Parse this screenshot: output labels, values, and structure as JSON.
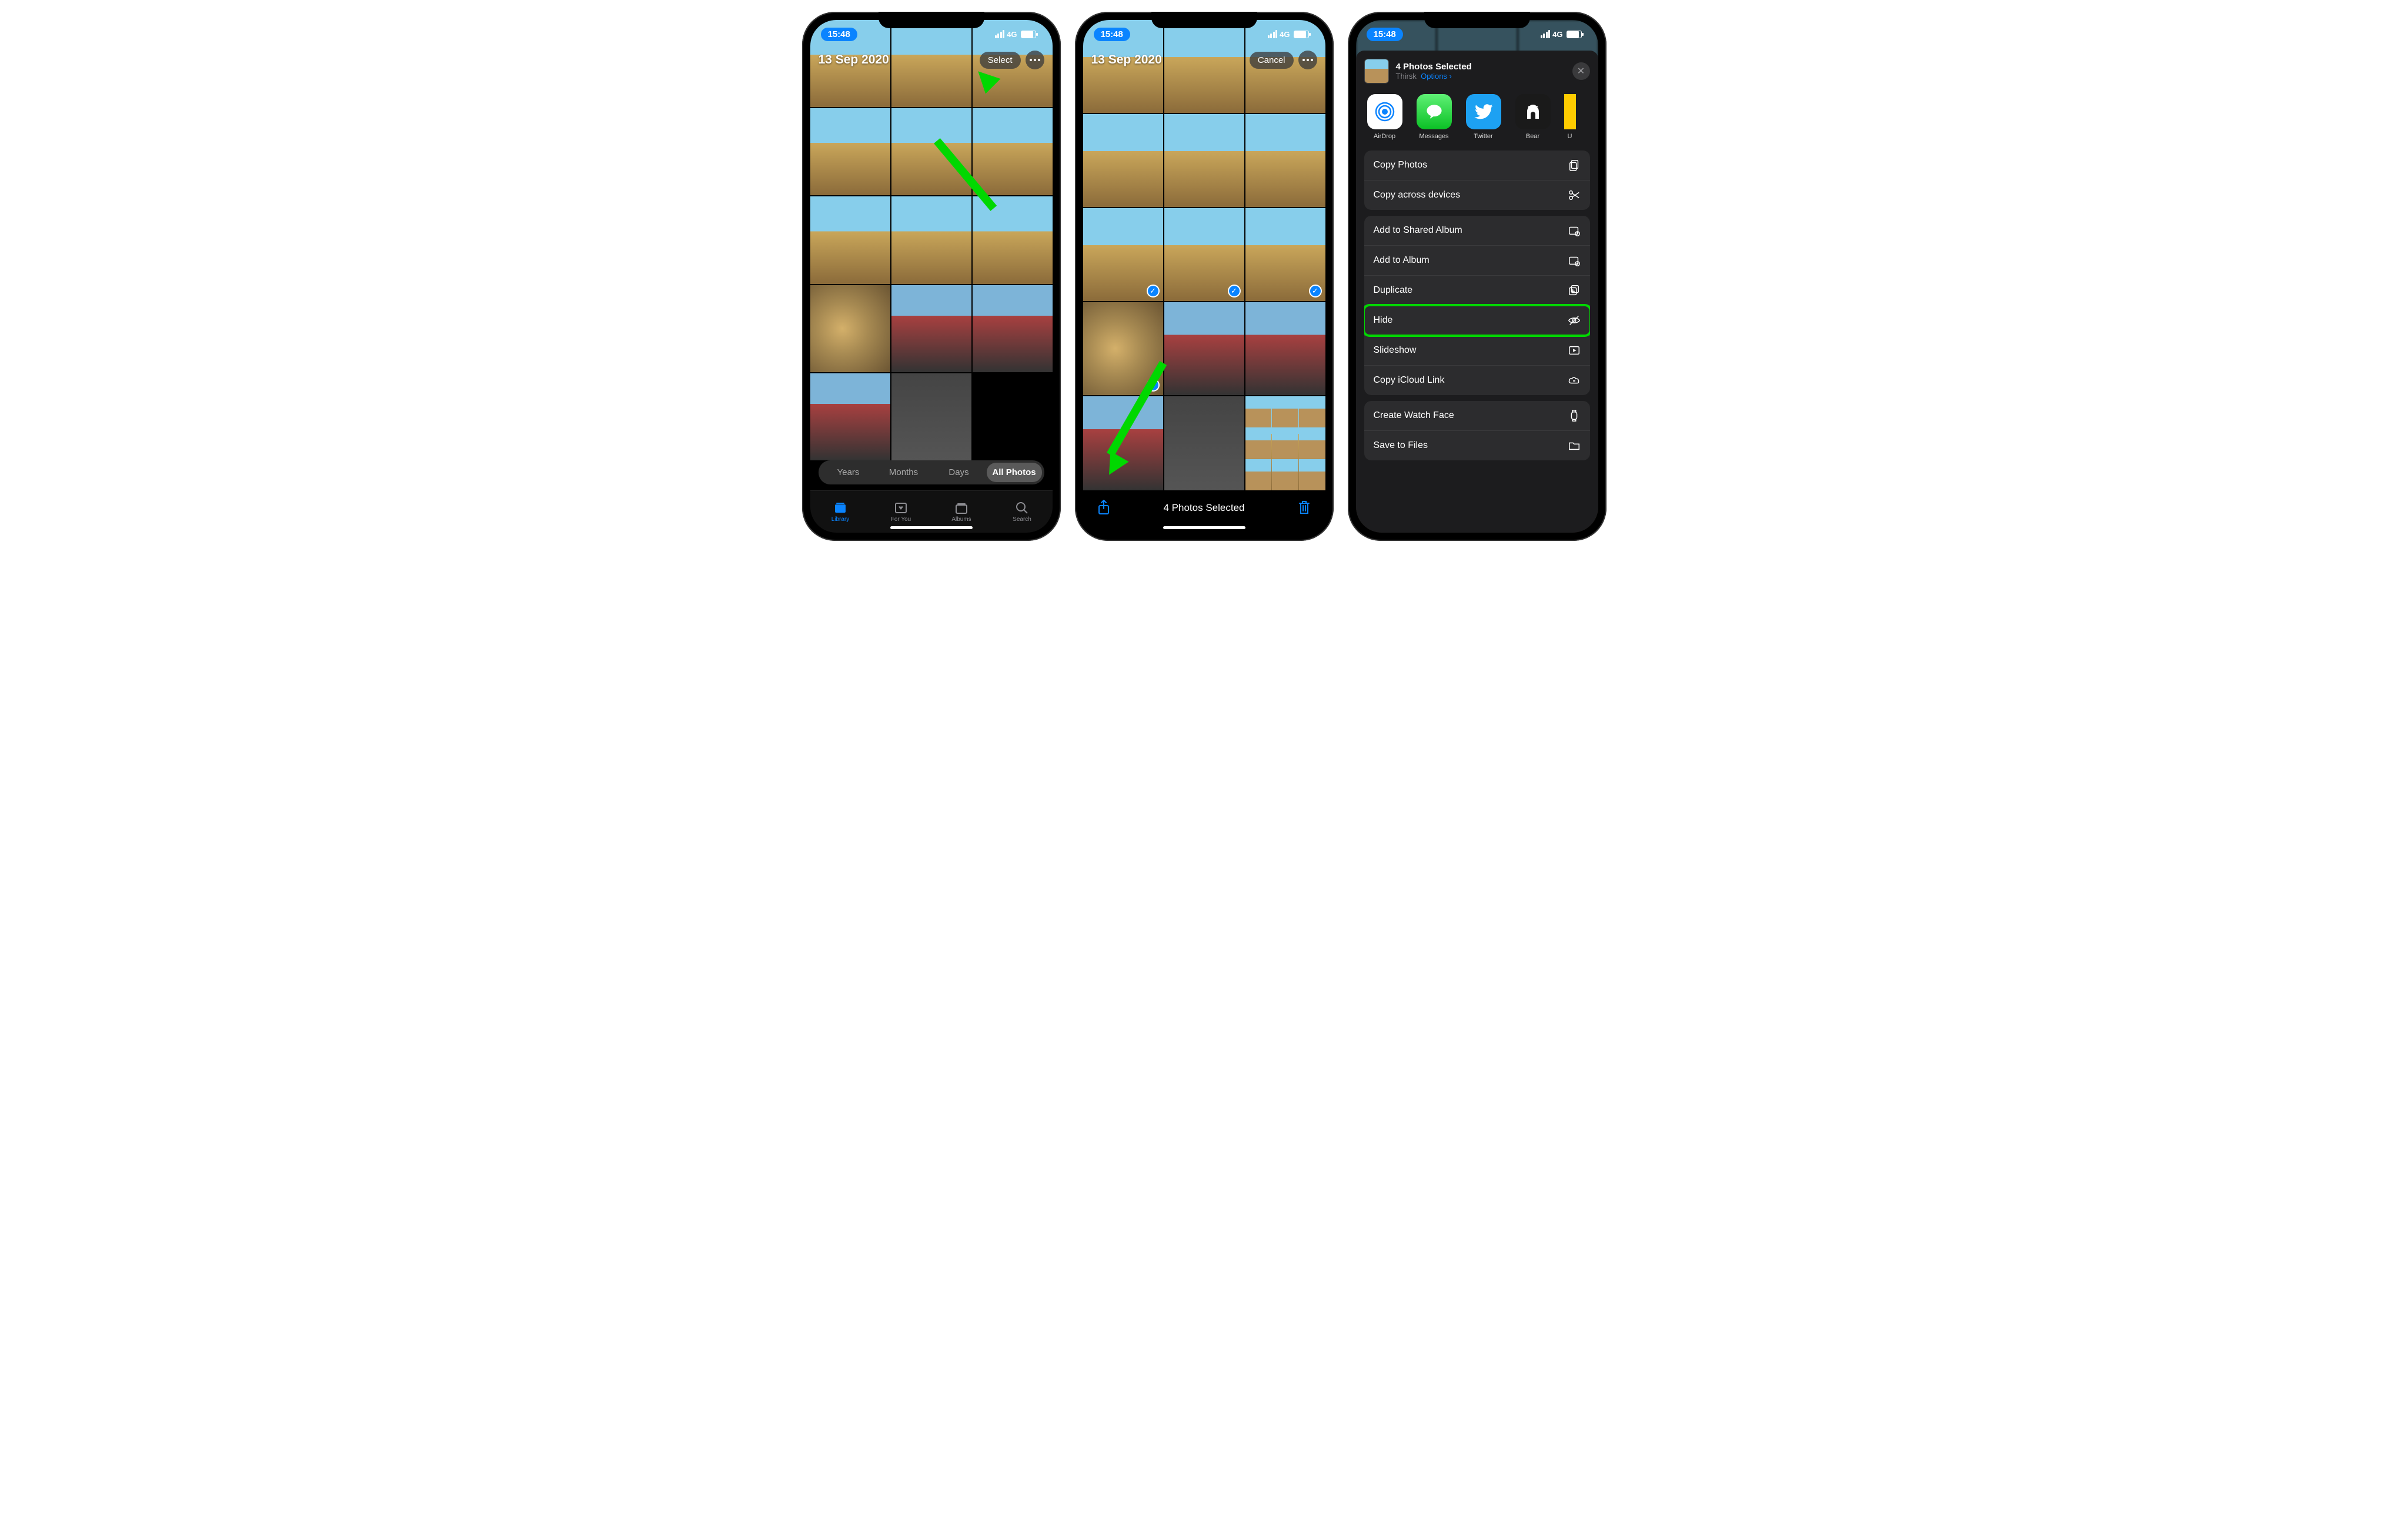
{
  "status": {
    "time": "15:48",
    "carrier": "4G"
  },
  "screen1": {
    "date": "13 Sep 2020",
    "select": "Select",
    "segments": {
      "years": "Years",
      "months": "Months",
      "days": "Days",
      "all": "All Photos"
    },
    "tabs": {
      "library": "Library",
      "foryou": "For You",
      "albums": "Albums",
      "search": "Search"
    }
  },
  "screen2": {
    "date": "13 Sep 2020",
    "cancel": "Cancel",
    "selected_label": "4 Photos Selected"
  },
  "screen3": {
    "title": "4 Photos Selected",
    "subtitle_location": "Thirsk",
    "subtitle_options": "Options",
    "apps": {
      "airdrop": "AirDrop",
      "messages": "Messages",
      "twitter": "Twitter",
      "bear": "Bear",
      "partial": "U"
    },
    "actions": {
      "copy_photos": "Copy Photos",
      "copy_across": "Copy across devices",
      "shared_album": "Add to Shared Album",
      "add_album": "Add to Album",
      "duplicate": "Duplicate",
      "hide": "Hide",
      "slideshow": "Slideshow",
      "icloud_link": "Copy iCloud Link",
      "watch_face": "Create Watch Face",
      "save_files": "Save to Files"
    }
  }
}
